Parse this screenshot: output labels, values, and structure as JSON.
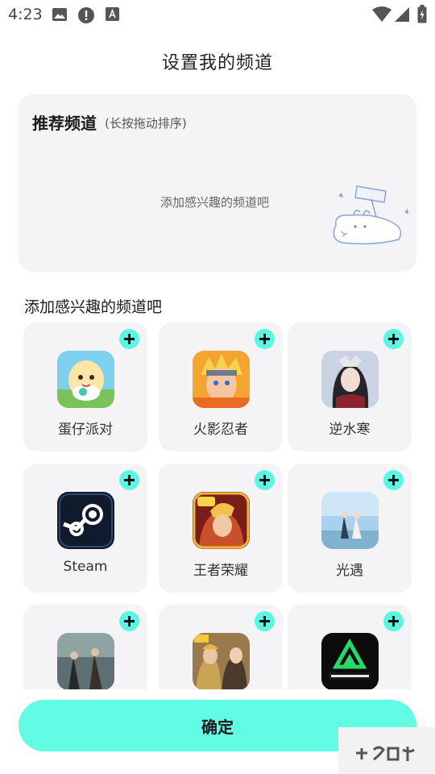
{
  "status_bar": {
    "time": "4:23",
    "icons": [
      "photo-icon",
      "alert-icon",
      "text-a-icon",
      "wifi-icon",
      "signal-icon",
      "battery-icon"
    ]
  },
  "page": {
    "title": "设置我的频道"
  },
  "recommended": {
    "title": "推荐频道",
    "hint": "(长按拖动排序)",
    "empty_text": "添加感兴趣的频道吧"
  },
  "add_section": {
    "title": "添加感兴趣的频道吧",
    "channels": [
      {
        "name": "蛋仔派对",
        "icon": "eggy-party-icon"
      },
      {
        "name": "火影忍者",
        "icon": "naruto-icon"
      },
      {
        "name": "逆水寒",
        "icon": "nishuihan-icon"
      },
      {
        "name": "Steam",
        "icon": "steam-icon"
      },
      {
        "name": "王者荣耀",
        "icon": "honor-of-kings-icon"
      },
      {
        "name": "光遇",
        "icon": "sky-icon"
      },
      {
        "name": "",
        "icon": "identity-v-icon"
      },
      {
        "name": "",
        "icon": "pubg-mobile-icon"
      },
      {
        "name": "",
        "icon": "delta-force-icon"
      }
    ]
  },
  "confirm_label": "确定",
  "colors": {
    "accent": "#62fbe4",
    "card_bg": "#f4f4f6"
  }
}
